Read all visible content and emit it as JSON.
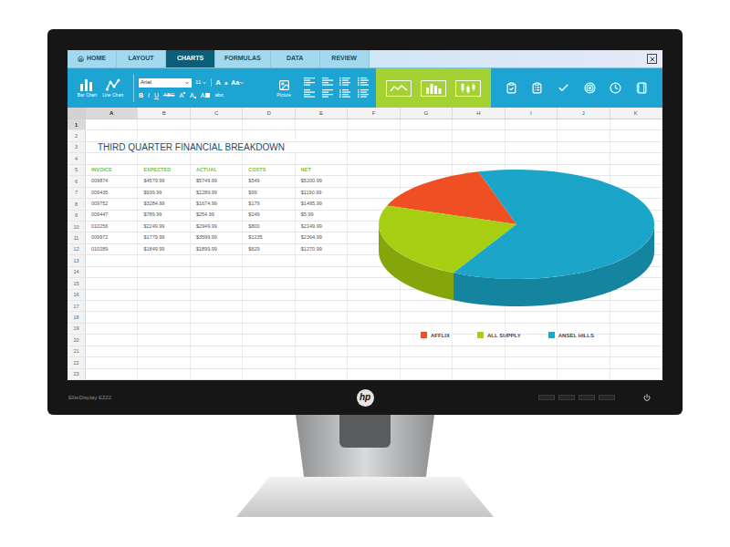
{
  "monitor": {
    "model": "EliteDisplay E222",
    "logo": "hp"
  },
  "tabs": [
    {
      "label": "HOME",
      "selected": false
    },
    {
      "label": "LAYOUT",
      "selected": false
    },
    {
      "label": "CHARTS",
      "selected": true
    },
    {
      "label": "FORMULAS",
      "selected": false
    },
    {
      "label": "DATA",
      "selected": false
    },
    {
      "label": "REVIEW",
      "selected": false
    }
  ],
  "ribbon": {
    "chart_buttons": [
      {
        "label": "Bar Chart",
        "kind": "bar"
      },
      {
        "label": "Line Chart",
        "kind": "line"
      }
    ],
    "font": {
      "family": "Arial",
      "size": "11"
    },
    "size_buttons": [
      {
        "text": "A",
        "kind": "grow"
      },
      {
        "text": "a",
        "kind": "shrink"
      },
      {
        "text": "Aa",
        "kind": "case"
      }
    ],
    "format_buttons": [
      {
        "text": "B",
        "kind": "bold"
      },
      {
        "text": "I",
        "kind": "italic"
      },
      {
        "text": "U",
        "kind": "underline"
      },
      {
        "text": "ABC",
        "kind": "strike"
      },
      {
        "text": "A",
        "kind": "superscript"
      },
      {
        "text": "A",
        "kind": "subscript"
      },
      {
        "text": "A",
        "kind": "font-color"
      },
      {
        "text": "abc",
        "kind": "highlight"
      }
    ],
    "picture": {
      "label": "Picture"
    }
  },
  "sheet": {
    "columns": [
      {
        "label": "A",
        "selected": true
      },
      {
        "label": "B",
        "selected": false
      },
      {
        "label": "C",
        "selected": false
      },
      {
        "label": "D",
        "selected": false
      },
      {
        "label": "E",
        "selected": false
      },
      {
        "label": "F",
        "selected": false
      },
      {
        "label": "G",
        "selected": false
      },
      {
        "label": "H",
        "selected": false
      },
      {
        "label": "I",
        "selected": false
      },
      {
        "label": "J",
        "selected": false
      },
      {
        "label": "K",
        "selected": false
      }
    ],
    "rows": [
      {
        "number": "1",
        "selected": true,
        "kind": "empty",
        "cells": []
      },
      {
        "number": "2",
        "selected": false,
        "kind": "empty",
        "cells": []
      },
      {
        "number": "3",
        "selected": false,
        "kind": "title",
        "cells": [
          "THIRD QUARTER FINANCIAL BREAKDOWN"
        ]
      },
      {
        "number": "4",
        "selected": false,
        "kind": "empty",
        "cells": []
      },
      {
        "number": "5",
        "selected": false,
        "kind": "header",
        "cells": [
          "INVOICE",
          "EXPECTED",
          "ACTUAL",
          "COSTS",
          "NET"
        ]
      },
      {
        "number": "6",
        "selected": false,
        "kind": "data",
        "cells": [
          "009874",
          "$4579.99",
          "$5749.99",
          "$549",
          "$5200.99"
        ]
      },
      {
        "number": "7",
        "selected": false,
        "kind": "data",
        "cells": [
          "009435",
          "$939.99",
          "$1289.99",
          "$99",
          "$1190.99"
        ]
      },
      {
        "number": "8",
        "selected": false,
        "kind": "data",
        "cells": [
          "009752",
          "$3284.99",
          "$1674.99",
          "$179",
          "$1495.99"
        ]
      },
      {
        "number": "9",
        "selected": false,
        "kind": "data",
        "cells": [
          "009447",
          "$789.99",
          "$254.99",
          "$249",
          "$5.99"
        ]
      },
      {
        "number": "10",
        "selected": false,
        "kind": "data",
        "cells": [
          "010256",
          "$2249.99",
          "$2949.99",
          "$800",
          "$2149.99"
        ]
      },
      {
        "number": "11",
        "selected": false,
        "kind": "data",
        "cells": [
          "009972",
          "$1779.99",
          "$3599.99",
          "$1235",
          "$2364.99"
        ]
      },
      {
        "number": "12",
        "selected": false,
        "kind": "data",
        "cells": [
          "010289",
          "$1849.99",
          "$1899.99",
          "$629",
          "$1270.99"
        ]
      },
      {
        "number": "13",
        "selected": false,
        "kind": "empty",
        "cells": []
      },
      {
        "number": "14",
        "selected": false,
        "kind": "empty",
        "cells": []
      },
      {
        "number": "15",
        "selected": false,
        "kind": "empty",
        "cells": []
      },
      {
        "number": "16",
        "selected": false,
        "kind": "empty",
        "cells": []
      },
      {
        "number": "17",
        "selected": false,
        "kind": "empty",
        "cells": []
      },
      {
        "number": "18",
        "selected": false,
        "kind": "empty",
        "cells": []
      },
      {
        "number": "19",
        "selected": false,
        "kind": "empty",
        "cells": []
      },
      {
        "number": "20",
        "selected": false,
        "kind": "empty",
        "cells": []
      },
      {
        "number": "21",
        "selected": false,
        "kind": "empty",
        "cells": []
      },
      {
        "number": "22",
        "selected": false,
        "kind": "empty",
        "cells": []
      },
      {
        "number": "23",
        "selected": false,
        "kind": "empty",
        "cells": []
      }
    ]
  },
  "chart": {
    "values": [
      15,
      23,
      62
    ],
    "legend": [
      {
        "label": "AFFLIX",
        "color": "#f04e23"
      },
      {
        "label": "ALL SUPPLY",
        "color": "#a6cf12"
      },
      {
        "label": "ANSEL HILLS",
        "color": "#1ba5c9"
      }
    ]
  }
}
